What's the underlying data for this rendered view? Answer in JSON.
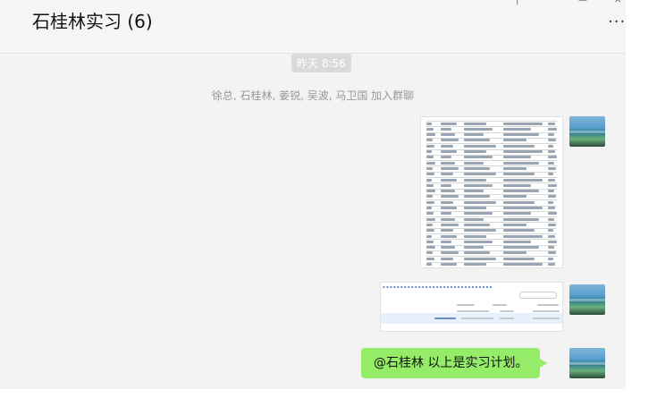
{
  "header": {
    "title": "石桂林实习 (6)",
    "more_label": "···"
  },
  "chat": {
    "time_badge": "昨天 8:56",
    "system_message": "徐总, 石桂林, 姜锐, 吴波, 马卫国 加入群聊",
    "messages": [
      {
        "type": "image",
        "description_icon": "document-table-image"
      },
      {
        "type": "image",
        "description_icon": "screenshot-image"
      },
      {
        "type": "text",
        "text": "@石桂林 以上是实习计划。"
      }
    ]
  },
  "colors": {
    "bubble": "#95ec69",
    "chat_bg": "#f3f3f3",
    "header_bg": "#f5f5f5"
  }
}
